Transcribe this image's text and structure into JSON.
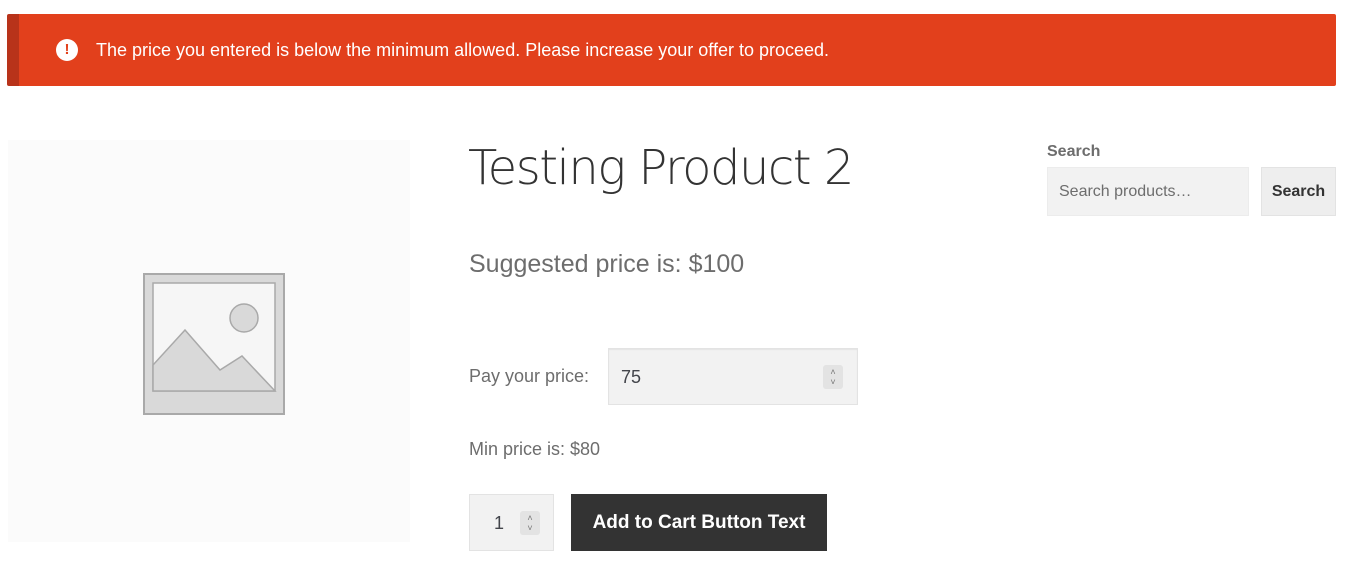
{
  "notice": {
    "type": "error",
    "icon": "exclamation-circle-icon",
    "message": "The price you entered is below the minimum allowed. Please increase your offer to proceed.",
    "color": "#e2401c"
  },
  "product": {
    "image_icon": "image-placeholder-icon",
    "title": "Testing Product 2",
    "suggested_price": "Suggested price is: $100",
    "pay_label": "Pay your price:",
    "price_value": "75",
    "min_price": "Min price is: $80",
    "quantity": "1",
    "add_to_cart_label": "Add to Cart Button Text",
    "button_color": "#333333"
  },
  "sidebar": {
    "search_heading": "Search",
    "search_placeholder": "Search products…",
    "search_button_label": "Search"
  }
}
